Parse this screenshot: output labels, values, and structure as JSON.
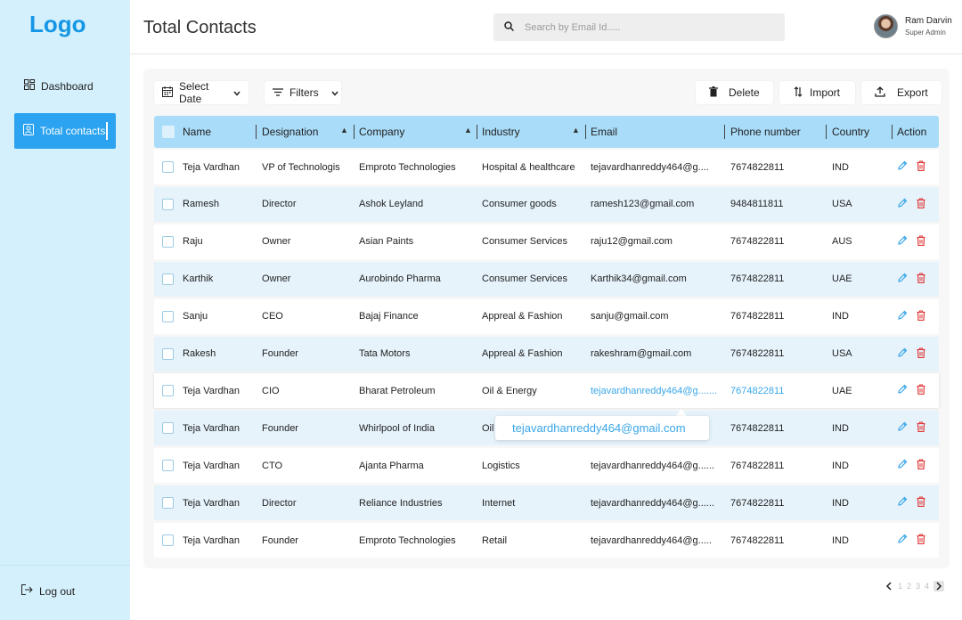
{
  "sidebar": {
    "logo": "Logo",
    "items": [
      {
        "label": "Dashboard",
        "icon": "grid-icon"
      },
      {
        "label": "Total contacts",
        "icon": "contact-card-icon",
        "active": true
      }
    ],
    "logout": "Log out"
  },
  "header": {
    "title": "Total Contacts",
    "search_placeholder": "Search by Email Id.....",
    "user_name": "Ram Darvin",
    "user_role": "Super Admin"
  },
  "toolbar": {
    "date_label": "Select Date",
    "filter_label": "Filters",
    "delete_label": "Delete",
    "import_label": "Import",
    "export_label": "Export"
  },
  "table": {
    "columns": [
      "Name",
      "Designation",
      "Company",
      "Industry",
      "Email",
      "Phone number",
      "Country",
      "Action"
    ],
    "rows": [
      {
        "name": "Teja Vardhan",
        "designation": "VP of Technologis",
        "company": "Emproto Technologies",
        "industry": "Hospital & healthcare",
        "email": "tejavardhanreddy464@g....",
        "phone": "7674822811",
        "country": "IND"
      },
      {
        "name": "Ramesh",
        "designation": "Director",
        "company": "Ashok Leyland",
        "industry": "Consumer goods",
        "email": "ramesh123@gmail.com",
        "phone": "9484811811",
        "country": "USA"
      },
      {
        "name": "Raju",
        "designation": "Owner",
        "company": "Asian Paints",
        "industry": "Consumer Services",
        "email": "raju12@gmail.com",
        "phone": "7674822811",
        "country": "AUS"
      },
      {
        "name": "Karthik",
        "designation": "Owner",
        "company": "Aurobindo Pharma",
        "industry": "Consumer Services",
        "email": "Karthik34@gmail.com",
        "phone": "7674822811",
        "country": "UAE"
      },
      {
        "name": "Sanju",
        "designation": "CEO",
        "company": "Bajaj Finance",
        "industry": "Appreal & Fashion",
        "email": "sanju@gmail.com",
        "phone": "7674822811",
        "country": "IND"
      },
      {
        "name": "Rakesh",
        "designation": "Founder",
        "company": "Tata Motors",
        "industry": "Appreal & Fashion",
        "email": "rakeshram@gmail.com",
        "phone": "7674822811",
        "country": "USA"
      },
      {
        "name": "Teja Vardhan",
        "designation": "CIO",
        "company": "Bharat Petroleum",
        "industry": "Oil & Energy",
        "email": "tejavardhanreddy464@g.......",
        "phone": "7674822811",
        "country": "UAE"
      },
      {
        "name": "Teja Vardhan",
        "designation": "Founder",
        "company": "Whirlpool of India",
        "industry": "Oil",
        "email": "",
        "phone": "7674822811",
        "country": "IND"
      },
      {
        "name": "Teja Vardhan",
        "designation": "CTO",
        "company": "Ajanta Pharma",
        "industry": "Logistics",
        "email": "tejavardhanreddy464@g......",
        "phone": "7674822811",
        "country": "IND"
      },
      {
        "name": "Teja Vardhan",
        "designation": "Director",
        "company": "Reliance Industries",
        "industry": "Internet",
        "email": "tejavardhanreddy464@g......",
        "phone": "7674822811",
        "country": "IND"
      },
      {
        "name": "Teja Vardhan",
        "designation": "Founder",
        "company": "Emproto Technologies",
        "industry": "Retail",
        "email": "tejavardhanreddy464@g.....",
        "phone": "7674822811",
        "country": "IND"
      }
    ]
  },
  "tooltip": {
    "text": "tejavardhanreddy464@gmail.com"
  },
  "pagination": {
    "pages": [
      "1",
      "2",
      "3",
      "4"
    ]
  },
  "colors": {
    "accent": "#2ba3f0",
    "sidebar_bg": "#d4f0fc",
    "header_row": "#a9dcf9",
    "link": "#39a6e8",
    "delete": "#e03a3a"
  }
}
